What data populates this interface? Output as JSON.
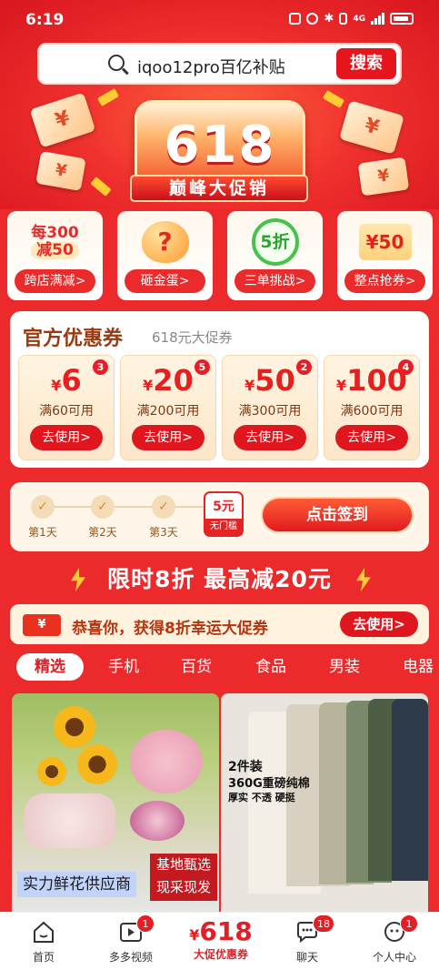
{
  "status_bar": {
    "time": "6:19",
    "network": "4G"
  },
  "search": {
    "query": "iqoo12pro百亿补贴",
    "button": "搜索"
  },
  "banner": {
    "big": "618",
    "ribbon": "巅峰大促销",
    "ticket_symbol": "¥"
  },
  "activities": [
    {
      "top": "每300",
      "bottom": "减50",
      "label": "跨店满减>"
    },
    {
      "icon_text": "?",
      "label": "砸金蛋>"
    },
    {
      "icon_text": "5折",
      "label": "三单挑战>"
    },
    {
      "icon_text": "¥50",
      "label": "整点抢券>"
    }
  ],
  "coupons": {
    "title": "官方优惠券",
    "subtitle": "618元大促券",
    "items": [
      {
        "symbol": "¥",
        "amount": "6",
        "badge": "3",
        "condition": "满60可用",
        "button": "去使用>"
      },
      {
        "symbol": "¥",
        "amount": "20",
        "badge": "5",
        "condition": "满200可用",
        "button": "去使用>"
      },
      {
        "symbol": "¥",
        "amount": "50",
        "badge": "2",
        "condition": "满300可用",
        "button": "去使用>"
      },
      {
        "symbol": "¥",
        "amount": "100",
        "badge": "4",
        "condition": "满600可用",
        "button": "去使用>"
      }
    ]
  },
  "checkin": {
    "days": [
      "第1天",
      "第2天",
      "第3天"
    ],
    "reward_amount": "5元",
    "reward_note": "无门槛",
    "button": "点击签到"
  },
  "flash": {
    "title": "限时8折 最高减20元"
  },
  "lucky": {
    "icon": "¥",
    "text": "恭喜你，获得8折幸运大促券",
    "button": "去使用>"
  },
  "tabs": [
    "精选",
    "手机",
    "百货",
    "食品",
    "男装",
    "电器"
  ],
  "products": [
    {
      "caption": "实力鲜花供应商",
      "tag_line1": "基地甄选",
      "tag_line2": "现采现发"
    },
    {
      "line1": "2件装",
      "line2": "360G重磅纯棉",
      "line3": "厚实 不透 硬挺"
    }
  ],
  "nav": {
    "home": "首页",
    "video": "多多视频",
    "video_badge": "1",
    "center_symbol": "¥",
    "center_value": "618",
    "center_label": "大促优惠券",
    "chat": "聊天",
    "chat_badge": "18",
    "profile": "个人中心",
    "profile_badge": "1"
  },
  "colors": {
    "brand_red": "#e21f26",
    "coupon_text": "#7a3a13"
  }
}
